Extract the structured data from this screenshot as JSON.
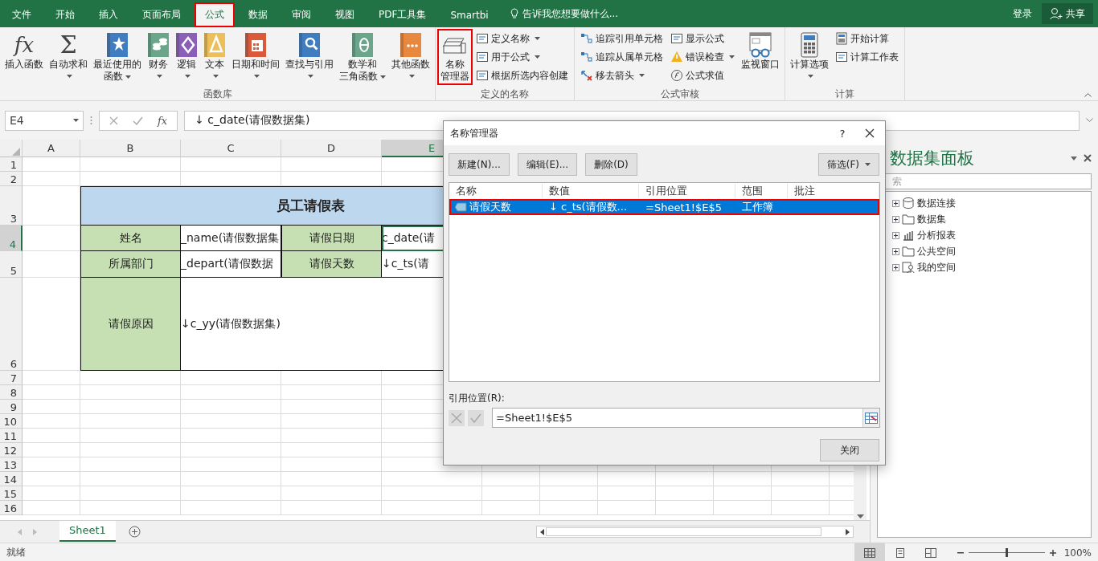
{
  "menu_tabs": [
    {
      "label": "文件",
      "selected": false
    },
    {
      "label": "开始",
      "selected": false
    },
    {
      "label": "插入",
      "selected": false
    },
    {
      "label": "页面布局",
      "selected": false
    },
    {
      "label": "公式",
      "selected": true
    },
    {
      "label": "数据",
      "selected": false
    },
    {
      "label": "审阅",
      "selected": false
    },
    {
      "label": "视图",
      "selected": false
    },
    {
      "label": "PDF工具集",
      "selected": false
    },
    {
      "label": "Smartbi",
      "selected": false
    }
  ],
  "tell_me": "告诉我您想要做什么...",
  "account": {
    "sign_in": "登录",
    "share": "共享"
  },
  "ribbon": {
    "groups": [
      {
        "label": "函数库",
        "items": [
          {
            "kind": "large",
            "glyph": "fx",
            "lines": [
              "插入函数"
            ],
            "dropdown": false,
            "highlighted": false
          },
          {
            "kind": "large",
            "glyph": "Σ",
            "lines": [
              "自动求和"
            ],
            "dropdown": true,
            "highlighted": false
          },
          {
            "kind": "large",
            "lines": [
              "最近使用的",
              "函数"
            ],
            "dropdown": true,
            "highlighted": false
          },
          {
            "kind": "large",
            "lines": [
              "财务"
            ],
            "dropdown": true,
            "highlighted": false
          },
          {
            "kind": "large",
            "lines": [
              "逻辑"
            ],
            "dropdown": true,
            "highlighted": false
          },
          {
            "kind": "large",
            "lines": [
              "文本"
            ],
            "dropdown": true,
            "highlighted": false
          },
          {
            "kind": "large",
            "lines": [
              "日期和时间"
            ],
            "dropdown": true,
            "highlighted": false
          },
          {
            "kind": "large",
            "lines": [
              "查找与引用"
            ],
            "dropdown": true,
            "highlighted": false
          },
          {
            "kind": "large",
            "lines": [
              "数学和",
              "三角函数"
            ],
            "dropdown": true,
            "highlighted": false
          },
          {
            "kind": "large",
            "lines": [
              "其他函数"
            ],
            "dropdown": true,
            "highlighted": false
          }
        ]
      },
      {
        "label": "定义的名称",
        "items": [
          {
            "kind": "large",
            "lines": [
              "名称",
              "管理器"
            ],
            "dropdown": false,
            "highlighted": true
          },
          {
            "kind": "stack",
            "items": [
              {
                "label": "定义名称",
                "dropdown": true
              },
              {
                "label": "用于公式",
                "dropdown": true
              },
              {
                "label": "根据所选内容创建",
                "dropdown": false
              }
            ]
          }
        ]
      },
      {
        "label": "公式审核",
        "items": [
          {
            "kind": "stack",
            "items": [
              {
                "label": "追踪引用单元格",
                "dropdown": false
              },
              {
                "label": "追踪从属单元格",
                "dropdown": false
              },
              {
                "label": "移去箭头",
                "dropdown": true
              }
            ]
          },
          {
            "kind": "stack",
            "items": [
              {
                "label": "显示公式",
                "dropdown": false
              },
              {
                "label": "错误检查",
                "dropdown": true
              },
              {
                "label": "公式求值",
                "dropdown": false
              }
            ]
          },
          {
            "kind": "large",
            "lines": [
              "监视窗口"
            ],
            "dropdown": false,
            "highlighted": false
          }
        ]
      },
      {
        "label": "计算",
        "items": [
          {
            "kind": "large",
            "lines": [
              "计算选项"
            ],
            "dropdown": true,
            "highlighted": false
          },
          {
            "kind": "stack",
            "items": [
              {
                "label": "开始计算",
                "dropdown": false
              },
              {
                "label": "计算工作表",
                "dropdown": false
              }
            ]
          }
        ]
      }
    ]
  },
  "formula_bar": {
    "name_box": "E4",
    "fx": "fx",
    "formula": "↓ c_date(请假数据集)"
  },
  "sheet": {
    "columns": [
      {
        "label": "A",
        "selected": false
      },
      {
        "label": "B",
        "selected": false
      },
      {
        "label": "C",
        "selected": false
      },
      {
        "label": "D",
        "selected": false
      },
      {
        "label": "E",
        "selected": true
      }
    ],
    "rows": [
      {
        "label": "1",
        "selected": false
      },
      {
        "label": "2",
        "selected": false
      },
      {
        "label": "3",
        "selected": false
      },
      {
        "label": "4",
        "selected": true
      },
      {
        "label": "5",
        "selected": false
      },
      {
        "label": "6",
        "selected": false
      },
      {
        "label": "7",
        "selected": false
      },
      {
        "label": "8",
        "selected": false
      },
      {
        "label": "9",
        "selected": false
      },
      {
        "label": "10",
        "selected": false
      },
      {
        "label": "11",
        "selected": false
      },
      {
        "label": "12",
        "selected": false
      },
      {
        "label": "13",
        "selected": false
      },
      {
        "label": "14",
        "selected": false
      },
      {
        "label": "15",
        "selected": false
      },
      {
        "label": "16",
        "selected": false
      }
    ]
  },
  "form": {
    "title": "员工请假表",
    "rows": [
      [
        {
          "kind": "label",
          "text": "姓名",
          "selected": false
        },
        {
          "kind": "value",
          "text": "_name(请假数据集",
          "selected": false
        },
        {
          "kind": "label",
          "text": "请假日期",
          "selected": false
        },
        {
          "kind": "value",
          "text": "c_date(请",
          "selected": true
        }
      ],
      [
        {
          "kind": "label",
          "text": "所属部门",
          "selected": false
        },
        {
          "kind": "value",
          "text": "_depart(请假数据",
          "selected": false
        },
        {
          "kind": "label",
          "text": "请假天数",
          "selected": false
        },
        {
          "kind": "value",
          "text": "↓c_ts(请",
          "selected": false
        }
      ],
      [
        {
          "kind": "label",
          "text": "请假原因",
          "selected": false
        },
        {
          "kind": "value",
          "text": "↓c_yy(请假数据集)",
          "selected": false
        }
      ]
    ]
  },
  "dialog": {
    "title": "名称管理器",
    "help": "?",
    "buttons": [
      "新建(N)...",
      "编辑(E)...",
      "删除(D)"
    ],
    "filter": "筛选(F)",
    "columns": [
      "名称",
      "数值",
      "引用位置",
      "范围",
      "批注"
    ],
    "rows": [
      {
        "name": "请假天数",
        "value": "↓ c_ts(请假数...",
        "refers_to": "=Sheet1!$E$5",
        "scope": "工作簿",
        "selected": true,
        "highlighted": true
      }
    ],
    "refers_label": "引用位置(R):",
    "refers_value": "=Sheet1!$E$5",
    "close": "关闭"
  },
  "panel": {
    "title": "数据集面板",
    "search_placeholder": "索",
    "tree": [
      {
        "label": "数据连接"
      },
      {
        "label": "数据集"
      },
      {
        "label": "分析报表"
      },
      {
        "label": "公共空间"
      },
      {
        "label": "我的空间"
      }
    ]
  },
  "sheet_tabs": [
    {
      "label": "Sheet1",
      "selected": true
    }
  ],
  "status_bar": {
    "status": "就绪",
    "views": [
      {
        "selected": true
      },
      {
        "selected": false
      },
      {
        "selected": false
      }
    ],
    "zoom": {
      "level": 0.5,
      "reading": "100%"
    }
  }
}
